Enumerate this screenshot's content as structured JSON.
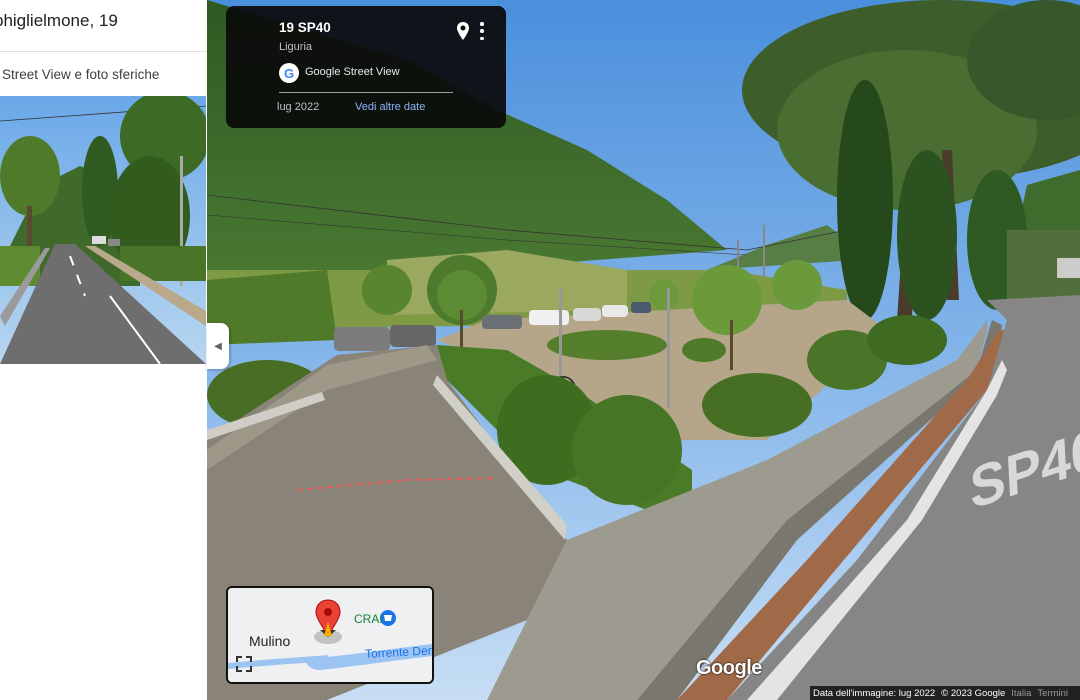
{
  "left_panel": {
    "place_title": "phiglielmone, 19",
    "section_label": "Street View e foto sferiche"
  },
  "info_card": {
    "address": "19 SP40",
    "region": "Liguria",
    "brand_logo_letter": "G",
    "brand": "Google Street View",
    "date": "lug 2022",
    "more_dates": "Vedi altre date"
  },
  "minimap": {
    "labels": {
      "place": "Mulino",
      "store": "CRAI",
      "river": "Torrente Derv"
    }
  },
  "street_view": {
    "road_marking": "SP40",
    "google_logo": "Google"
  },
  "footer": {
    "image_date": "Data dell'immagine: lug 2022",
    "copyright": "© 2023 Google",
    "country": "Italia",
    "terms": "Termini"
  },
  "icons": {
    "collapse": "chevron-left-icon",
    "pin": "location-pin-icon",
    "menu": "more-vert-icon",
    "fullscreen": "fullscreen-icon"
  },
  "colors": {
    "link": "#8ab4f8",
    "card_bg": "#0a0a0a",
    "pin_red": "#ea4335"
  }
}
